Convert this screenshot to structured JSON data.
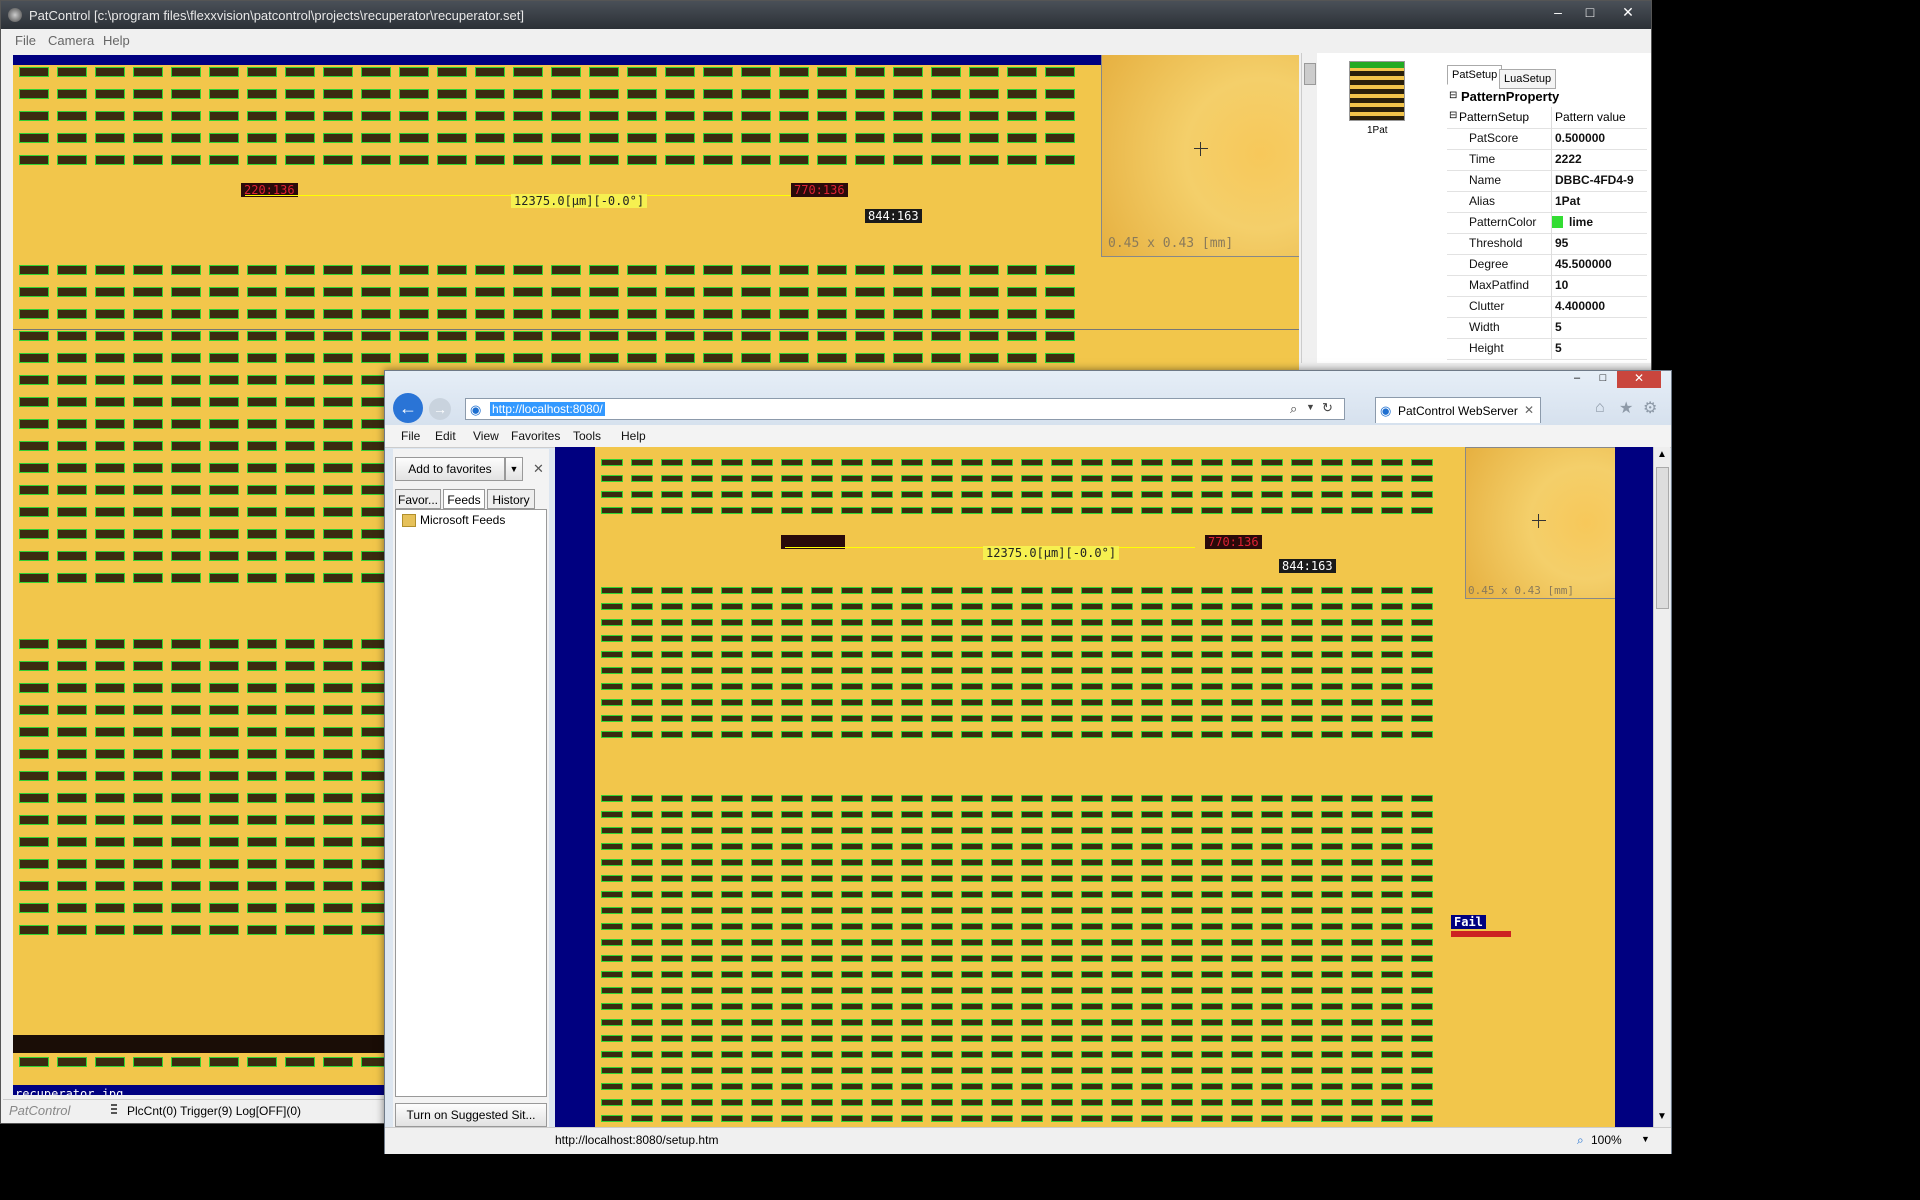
{
  "pc": {
    "title": "PatControl [c:\\program files\\flexxvision\\patcontrol\\projects\\recuperator\\recuperator.set]",
    "menu": [
      "File",
      "Camera",
      "Help"
    ],
    "overlay": {
      "label_left": "220:136",
      "measure": "12375.0[µm][-0.0°]",
      "label_right": "770:136",
      "label_coord": "844:163",
      "zoom_text": "0.45 x 0.43 [mm]",
      "file_label": "recuperator.jpg"
    },
    "pattern_thumb_label": "1Pat",
    "tabs": [
      "PatSetup",
      "LuaSetup"
    ],
    "property_header": "PatternProperty",
    "pattern_setup": {
      "key": "PatternSetup",
      "value": "Pattern value"
    },
    "properties": [
      {
        "k": "PatScore",
        "v": "0.500000"
      },
      {
        "k": "Time",
        "v": "2222"
      },
      {
        "k": "Name",
        "v": "DBBC-4FD4-9"
      },
      {
        "k": "Alias",
        "v": "1Pat"
      },
      {
        "k": "PatternColor",
        "v": "lime"
      },
      {
        "k": "Threshold",
        "v": "95"
      },
      {
        "k": "Degree",
        "v": "45.500000"
      },
      {
        "k": "MaxPatfind",
        "v": "10"
      },
      {
        "k": "Clutter",
        "v": "4.400000"
      },
      {
        "k": "Width",
        "v": "5"
      },
      {
        "k": "Height",
        "v": "5"
      }
    ],
    "pattern_color_hex": "#33dd33",
    "status": {
      "brand": "PatControl",
      "text": "PlcCnt(0) Trigger(9) Log[OFF](0)"
    }
  },
  "ie": {
    "url": "http://localhost:8080/",
    "tab_title": "PatControl WebServer",
    "menu": [
      "File",
      "Edit",
      "View",
      "Favorites",
      "Tools",
      "Help"
    ],
    "add_favorites": "Add to favorites",
    "fav_tabs": [
      "Favor...",
      "Feeds",
      "History"
    ],
    "feeds_item": "Microsoft Feeds",
    "suggested": "Turn on Suggested Sit...",
    "overlay": {
      "measure": "12375.0[µm][-0.0°]",
      "label_right": "770:136",
      "label_coord": "844:163",
      "zoom_text": "0.45 x 0.43 [mm]",
      "fail": "Fail"
    },
    "status_url": "http://localhost:8080/setup.htm",
    "zoom": "100%"
  }
}
